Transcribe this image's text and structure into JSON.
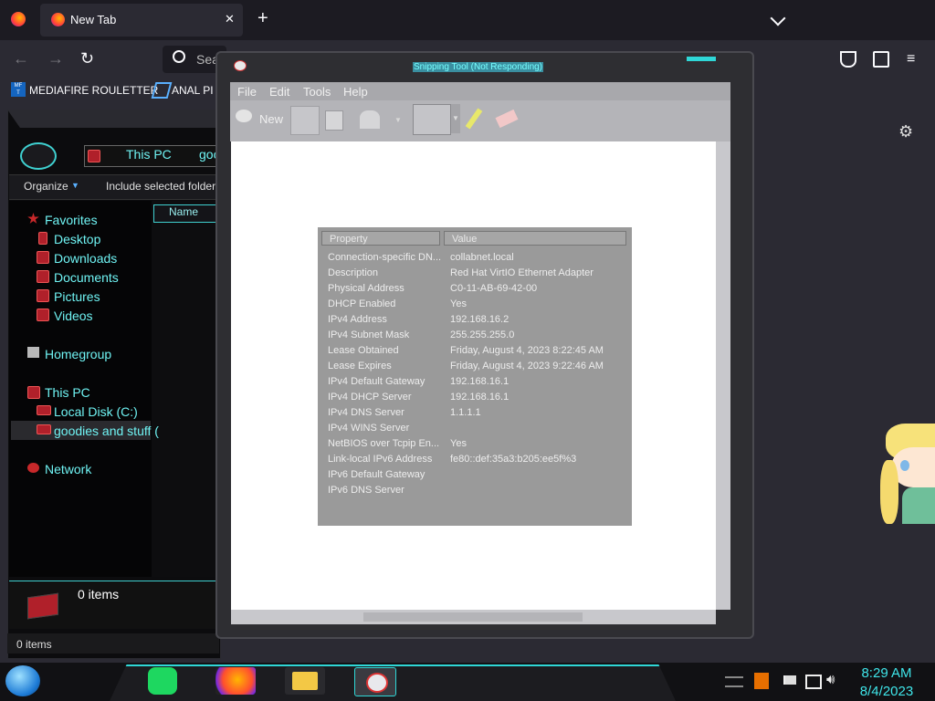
{
  "browser": {
    "tab_title": "New Tab",
    "new_tab_symbol": "+",
    "close_symbol": "✕",
    "search_placeholder": "Sea",
    "bookmarks": [
      {
        "label": "MEDIAFIRE ROULETTER",
        "icon": "mediafire-icon"
      },
      {
        "label": "ANAL PI",
        "icon": "bookmark-icon"
      }
    ]
  },
  "explorer": {
    "breadcrumb": [
      "This PC",
      "goo"
    ],
    "organize_label": "Organize",
    "include_label": "Include selected folder",
    "column_name": "Name",
    "nav": {
      "favorites": "Favorites",
      "favorites_items": [
        "Desktop",
        "Downloads",
        "Documents",
        "Pictures",
        "Videos"
      ],
      "homegroup": "Homegroup",
      "this_pc": "This PC",
      "this_pc_items": [
        "Local Disk (C:)",
        "goodies and stuff ("
      ],
      "network": "Network"
    },
    "details_count": "0 items",
    "status_count": "0 items"
  },
  "snipping_tool": {
    "title": "Snipping Tool (Not Responding)",
    "menu": [
      "File",
      "Edit",
      "Tools",
      "Help"
    ],
    "new_label": "New",
    "captured": {
      "headers": [
        "Property",
        "Value"
      ],
      "rows": [
        {
          "p": "Connection-specific DN...",
          "v": "collabnet.local"
        },
        {
          "p": "Description",
          "v": "Red Hat VirtIO Ethernet Adapter"
        },
        {
          "p": "Physical Address",
          "v": "C0-11-AB-69-42-00"
        },
        {
          "p": "DHCP Enabled",
          "v": "Yes"
        },
        {
          "p": "IPv4 Address",
          "v": "192.168.16.2"
        },
        {
          "p": "IPv4 Subnet Mask",
          "v": "255.255.255.0"
        },
        {
          "p": "Lease Obtained",
          "v": "Friday, August 4, 2023 8:22:45 AM"
        },
        {
          "p": "Lease Expires",
          "v": "Friday, August 4, 2023 9:22:46 AM"
        },
        {
          "p": "IPv4 Default Gateway",
          "v": "192.168.16.1"
        },
        {
          "p": "IPv4 DHCP Server",
          "v": "192.168.16.1"
        },
        {
          "p": "IPv4 DNS Server",
          "v": "1.1.1.1"
        },
        {
          "p": "IPv4 WINS Server",
          "v": ""
        },
        {
          "p": "NetBIOS over Tcpip En...",
          "v": "Yes"
        },
        {
          "p": "Link-local IPv6 Address",
          "v": "fe80::def:35a3:b205:ee5f%3"
        },
        {
          "p": "IPv6 Default Gateway",
          "v": ""
        },
        {
          "p": "IPv6 DNS Server",
          "v": ""
        }
      ]
    }
  },
  "taskbar": {
    "apps": [
      "firefox-icon",
      "file-explorer-icon",
      "snipping-tool-icon"
    ],
    "time": "8:29 AM",
    "date": "8/4/2023"
  },
  "colors": {
    "accent": "#3fe6ea",
    "nav_text": "#6ff3f3"
  }
}
